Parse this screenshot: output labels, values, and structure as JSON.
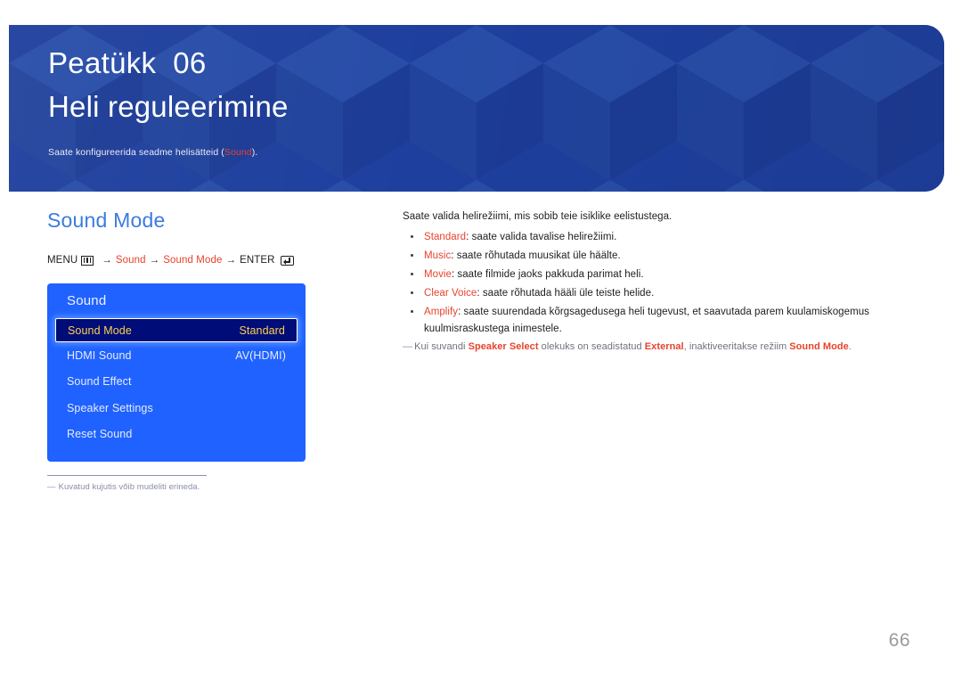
{
  "header": {
    "chapter_label": "Peatükk  06",
    "chapter_title": "Heli reguleerimine",
    "subtitle_before": "Saate konfigureerida seadme helisätteid (",
    "subtitle_highlight": "Sound",
    "subtitle_after": ").",
    "bg_color": "#1e3f9e"
  },
  "section": {
    "title": "Sound Mode",
    "title_color": "#3d7ae0"
  },
  "menu_path": {
    "menu_label": "MENU",
    "menu_icon": "menu-icon",
    "arrow": "→",
    "step1": "Sound",
    "step2": "Sound Mode",
    "enter_label": "ENTER",
    "enter_icon": "enter-icon",
    "accent_color": "#e8432c"
  },
  "osd": {
    "title": "Sound",
    "panel_color": "#1f62ff",
    "selected_bg": "#000c78",
    "selected_text_color": "#ffd24a",
    "rows": [
      {
        "label": "Sound Mode",
        "value": "Standard",
        "selected": true
      },
      {
        "label": "HDMI Sound",
        "value": "AV(HDMI)",
        "selected": false
      },
      {
        "label": "Sound Effect",
        "value": "",
        "selected": false
      },
      {
        "label": "Speaker Settings",
        "value": "",
        "selected": false
      },
      {
        "label": "Reset Sound",
        "value": "",
        "selected": false
      }
    ]
  },
  "footnote": {
    "dash": "―",
    "text": "Kuvatud kujutis võib mudeliti erineda."
  },
  "content": {
    "intro": "Saate valida helirežiimi, mis sobib teie isiklike eelistustega.",
    "bullets": [
      {
        "keyword": "Standard",
        "text": ": saate valida tavalise helirežiimi."
      },
      {
        "keyword": "Music",
        "text": ": saate rõhutada muusikat üle häälte."
      },
      {
        "keyword": "Movie",
        "text": ": saate filmide jaoks pakkuda parimat heli."
      },
      {
        "keyword": "Clear Voice",
        "text": ": saate rõhutada hääli üle teiste helide."
      },
      {
        "keyword": "Amplify",
        "text": ": saate suurendada kõrgsagedusega heli tugevust, et saavutada parem kuulamiskogemus kuulmisraskustega inimestele."
      }
    ],
    "note": {
      "dash": "―",
      "part1": "Kui suvandi ",
      "kw1": "Speaker Select",
      "part2": " olekuks on seadistatud ",
      "kw2": "External",
      "part3": ", inaktiveeritakse režiim ",
      "kw3": "Sound Mode",
      "part4": "."
    }
  },
  "page_number": "66"
}
